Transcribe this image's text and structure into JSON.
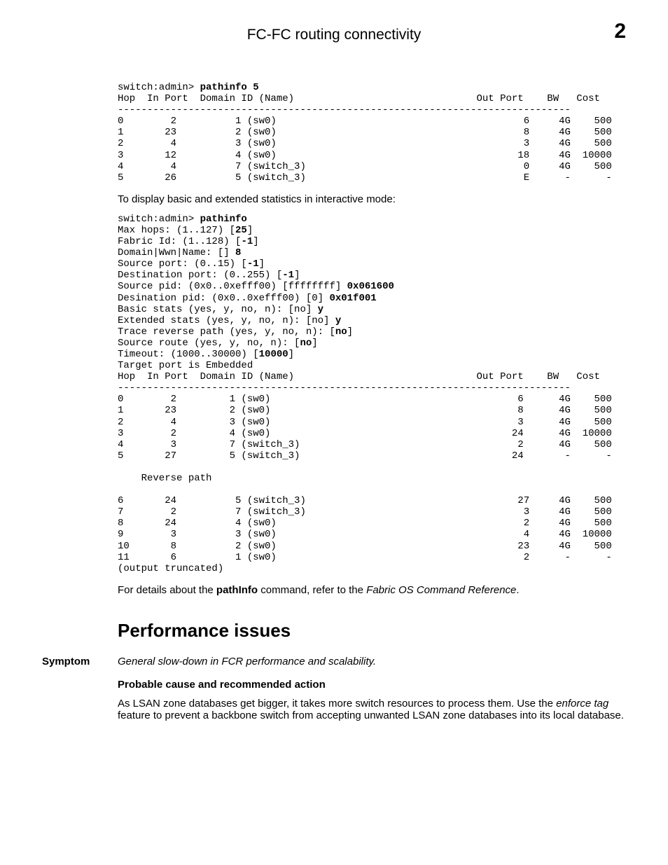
{
  "header": {
    "title": "FC-FC routing connectivity",
    "chapter_number": "2"
  },
  "term1": {
    "prompt": "switch:admin>",
    "cmd": "pathinfo 5",
    "header_line": "Hop  In Port  Domain ID (Name)                               Out Port    BW   Cost",
    "rule": "-----------------------------------------------------------------------------",
    "rows": [
      "0        2          1 (sw0)                                          6     4G    500",
      "1       23          2 (sw0)                                          8     4G    500",
      "2        4          3 (sw0)                                          3     4G    500",
      "3       12          4 (sw0)                                         18     4G  10000",
      "4        4          7 (switch_3)                                     0     4G    500",
      "5       26          5 (switch_3)                                     E      -      -"
    ]
  },
  "intro2": "To display basic and extended statistics in interactive mode:",
  "term2": {
    "prompt": "switch:admin>",
    "cmd": "pathinfo",
    "lines": [
      {
        "pre": "Max hops: (1..127) [",
        "b": "25",
        "post": "]"
      },
      {
        "pre": "Fabric Id: (1..128) [",
        "b": "-1",
        "post": "]"
      },
      {
        "pre": "Domain|Wwn|Name: [] ",
        "b": "8",
        "post": ""
      },
      {
        "pre": "Source port: (0..15) [",
        "b": "-1",
        "post": "]"
      },
      {
        "pre": "Destination port: (0..255) [",
        "b": "-1",
        "post": "]"
      },
      {
        "pre": "Source pid: (0x0..0xefff00) [ffffffff] ",
        "b": "0x061600",
        "post": ""
      },
      {
        "pre": "Desination pid: (0x0..0xefff00) [0] ",
        "b": "0x01f001",
        "post": ""
      },
      {
        "pre": "Basic stats (yes, y, no, n): [no] ",
        "b": "y",
        "post": ""
      },
      {
        "pre": "Extended stats (yes, y, no, n): [no] ",
        "b": "y",
        "post": ""
      },
      {
        "pre": "Trace reverse path (yes, y, no, n): [",
        "b": "no",
        "post": "]"
      },
      {
        "pre": "Source route (yes, y, no, n): [",
        "b": "no",
        "post": "]"
      },
      {
        "pre": "Timeout: (1000..30000) [",
        "b": "10000",
        "post": "]"
      },
      {
        "pre": "Target port is Embedded",
        "b": "",
        "post": ""
      }
    ],
    "header_line": "Hop  In Port  Domain ID (Name)                               Out Port    BW   Cost",
    "rule": "-----------------------------------------------------------------------------",
    "fwd_rows": [
      "0        2         1 (sw0)                                          6      4G    500",
      "1       23         2 (sw0)                                          8      4G    500",
      "2        4         3 (sw0)                                          3      4G    500",
      "3        2         4 (sw0)                                         24      4G  10000",
      "4        3         7 (switch_3)                                     2      4G    500",
      "5       27         5 (switch_3)                                    24       -      -"
    ],
    "reverse_label": "    Reverse path",
    "rev_rows": [
      "6       24          5 (switch_3)                                    27     4G    500",
      "7        2          7 (switch_3)                                     3     4G    500",
      "8       24          4 (sw0)                                          2     4G    500",
      "9        3          3 (sw0)                                          4     4G  10000",
      "10       8          2 (sw0)                                         23     4G    500",
      "11       6          1 (sw0)                                          2      -      -"
    ],
    "truncated": "(output truncated)"
  },
  "closing_text": {
    "pre": "For details about the ",
    "cmd": "pathInfo",
    "mid": " command, refer to the ",
    "ital": "Fabric OS Command Reference",
    "post": "."
  },
  "perf": {
    "heading": "Performance issues",
    "symptom_label": "Symptom",
    "symptom_text": "General slow-down in FCR performance and scalability.",
    "cause_head": "Probable cause and recommended action",
    "cause_body_pre": "As LSAN zone databases get bigger, it takes more switch resources to process them. Use the ",
    "cause_body_ital": "enforce tag",
    "cause_body_post": " feature to prevent a backbone switch from accepting unwanted LSAN zone databases into its local database."
  }
}
